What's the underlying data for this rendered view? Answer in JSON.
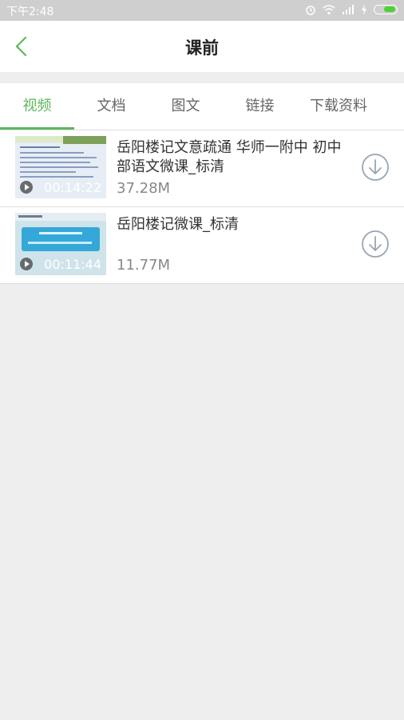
{
  "status_bar": {
    "time": "下午2:48"
  },
  "header": {
    "title": "课前"
  },
  "tabs": [
    {
      "label": "视频"
    },
    {
      "label": "文档"
    },
    {
      "label": "图文"
    },
    {
      "label": "链接"
    },
    {
      "label": "下载资料"
    }
  ],
  "videos": [
    {
      "title": "岳阳楼记文意疏通 华师一附中 初中部语文微课_标清",
      "duration": "00:14:22",
      "size": "37.28M"
    },
    {
      "title": "岳阳楼记微课_标清",
      "duration": "00:11:44",
      "size": "11.77M"
    }
  ],
  "colors": {
    "accent": "#5cb85c",
    "icon_gray": "#9aa6b2"
  }
}
